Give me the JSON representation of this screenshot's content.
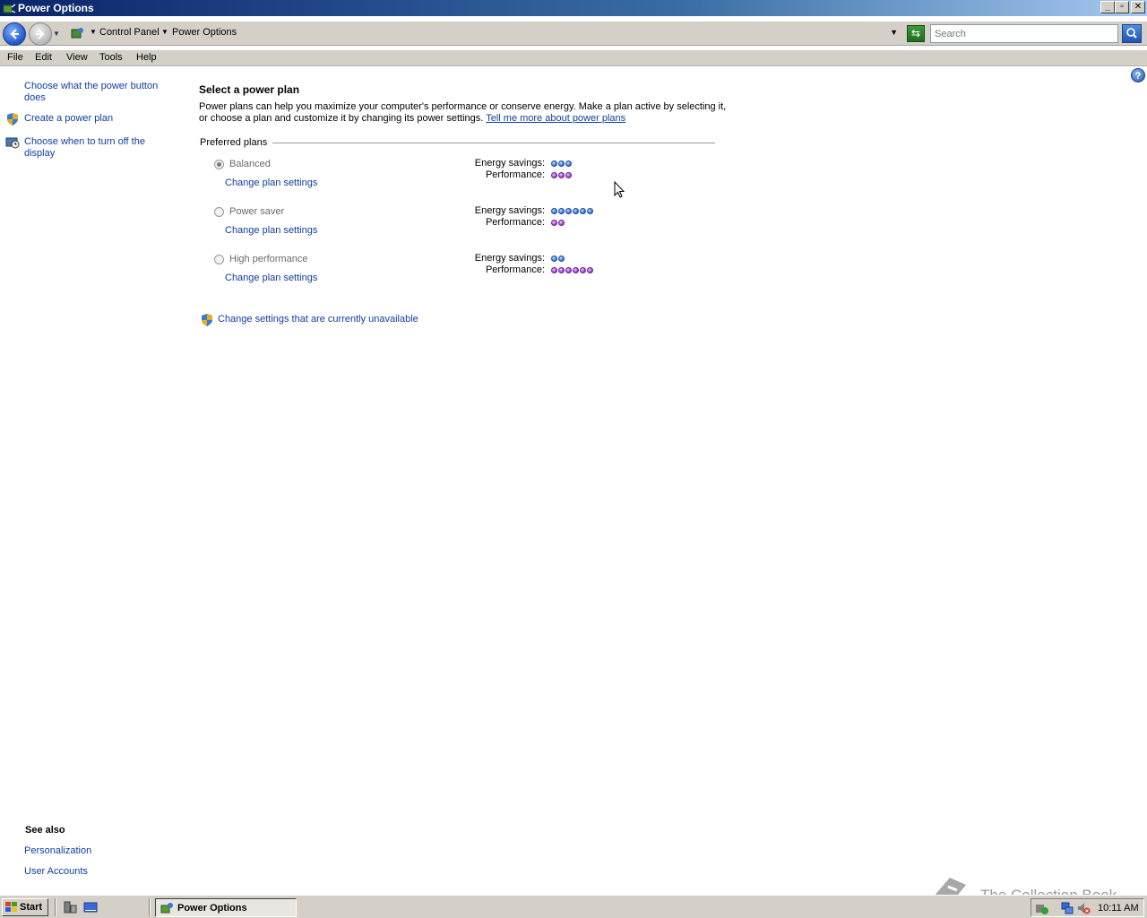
{
  "window": {
    "title": "Power Options"
  },
  "address": {
    "crumbs": [
      "Control Panel",
      "Power Options"
    ],
    "search_placeholder": "Search"
  },
  "menu": [
    "File",
    "Edit",
    "View",
    "Tools",
    "Help"
  ],
  "left_tasks": [
    {
      "label": "Choose what the power button does",
      "icon": "none"
    },
    {
      "label": "Create a power plan",
      "icon": "shield-icon"
    },
    {
      "label": "Choose when to turn off the display",
      "icon": "clock-monitor-icon"
    }
  ],
  "main": {
    "title": "Select a power plan",
    "description": "Power plans can help you maximize your computer's performance or conserve energy. Make a plan active by selecting it, or choose a plan and customize it by changing its power settings.",
    "learn_more": "Tell me more about power plans",
    "preferred_label": "Preferred plans",
    "energy_label": "Energy savings:",
    "performance_label": "Performance:",
    "plans": [
      {
        "name": "Balanced",
        "selected": true,
        "change": "Change plan settings",
        "energy": 3,
        "performance": 3
      },
      {
        "name": "Power saver",
        "selected": false,
        "change": "Change plan settings",
        "energy": 6,
        "performance": 2
      },
      {
        "name": "High performance",
        "selected": false,
        "change": "Change plan settings",
        "energy": 2,
        "performance": 6
      }
    ],
    "unavailable": "Change settings that are currently unavailable"
  },
  "see_also": {
    "title": "See also",
    "links": [
      "Personalization",
      "User Accounts"
    ]
  },
  "watermark": "The Collection Book",
  "taskbar": {
    "start": "Start",
    "task": "Power Options",
    "clock": "10:11 AM"
  },
  "colors": {
    "link": "#0f3ea3",
    "energy_dot": "#2a6fd0",
    "performance_dot": "#9a3cc8"
  }
}
